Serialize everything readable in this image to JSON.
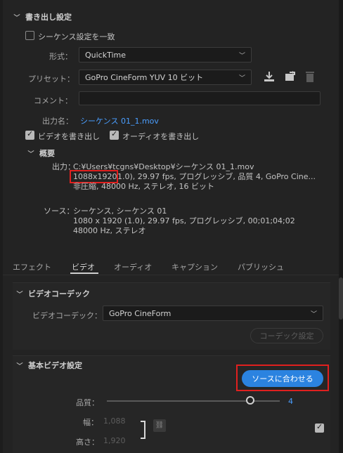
{
  "export_settings": {
    "header": "書き出し設定",
    "match_sequence_label": "シーケンス設定を一致",
    "format_label": "形式：",
    "format_value": "QuickTime",
    "preset_label": "プリセット：",
    "preset_value": "GoPro CineForm YUV 10 ビット",
    "comment_label": "コメント：",
    "output_name_label": "出力名：",
    "output_name_value": "シーケンス 01_1.mov",
    "export_video_label": "ビデオを書き出し",
    "export_audio_label": "オーディオを書き出し"
  },
  "summary": {
    "header": "概要",
    "output_label": "出力：",
    "output_path": "C:¥Users¥tcgns¥Desktop¥シーケンス 01_1.mov",
    "output_resolution": "1088x1920",
    "output_line2_rest": " 1.0), 29.97 fps, プログレッシブ, 品質 4, GoPro Cine...",
    "output_line3": "非圧縮, 48000 Hz, ステレオ, 16 ビット",
    "source_label": "ソース：",
    "source_line1": "シーケンス, シーケンス 01",
    "source_line2": "1080 x 1920 (1.0), 29.97 fps, プログレッシブ, 00;01;04;02",
    "source_line3": "48000 Hz, ステレオ"
  },
  "tabs": [
    "エフェクト",
    "ビデオ",
    "オーディオ",
    "キャプション",
    "パブリッシュ"
  ],
  "video_codec": {
    "header": "ビデオコーデック",
    "codec_label": "ビデオコーデック：",
    "codec_value": "GoPro CineForm",
    "codec_settings_button": "コーデック設定"
  },
  "basic_video": {
    "header": "基本ビデオ設定",
    "match_source_button": "ソースに合わせる",
    "quality_label": "品質：",
    "quality_value": "4",
    "quality_fraction": 0.83,
    "width_label": "幅：",
    "width_value": "1,088",
    "height_label": "高さ：",
    "height_value": "1,920"
  },
  "colors": {
    "accent": "#2b83e0",
    "link": "#4a9eff",
    "highlight": "#e0201f"
  }
}
